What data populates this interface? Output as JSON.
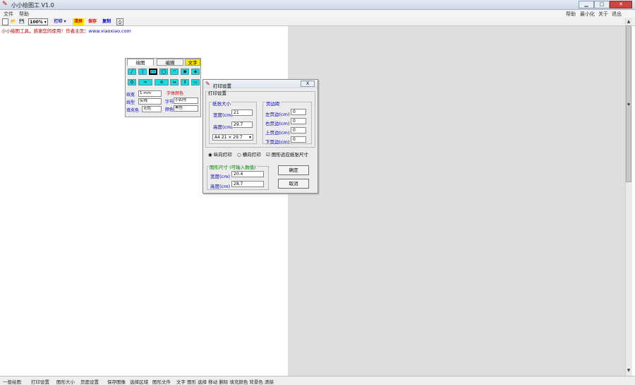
{
  "window": {
    "title": "小小绘图工 V1.0",
    "minimize": "▁",
    "maximize": "□",
    "close": "✕"
  },
  "menubar": {
    "items": [
      "文件",
      "帮助"
    ],
    "right": [
      "帮助",
      "最小化",
      "关于",
      "退出"
    ]
  },
  "toolbar": {
    "zoom": "100%",
    "mode": "打印",
    "buttons": [
      "清屏",
      "保存",
      "复制"
    ],
    "accent_red": "#d40000",
    "accent_blue": "#0000cc"
  },
  "canvas": {
    "url_red": "小小绘图工具，感谢您的使用！作者主页：",
    "url_blue": "www.xiaoxiao.com"
  },
  "palette": {
    "tabs": [
      "绘图",
      "编辑",
      "文字"
    ],
    "row1": [
      "╱",
      "│",
      "□",
      "◯",
      "◠",
      "◉",
      "◈"
    ],
    "row2": [
      "⛭",
      "≈",
      "≋",
      "↔",
      "↕",
      "▭"
    ],
    "fields": [
      {
        "label": "线宽",
        "value": "1 mm"
      },
      {
        "label": "线型",
        "value": "实线"
      },
      {
        "label": "填充色",
        "value": "无色"
      }
    ],
    "right_label": "字体颜色",
    "right_fields": [
      {
        "label": "字号",
        "value": "小四号"
      },
      {
        "label": "颜色",
        "value": "黑色"
      }
    ]
  },
  "dialog": {
    "title": "打印设置",
    "close": "X",
    "group_label": "打印设置",
    "paper_group": "纸张大小",
    "width_label": "宽度(cm)",
    "width_value": "21",
    "height_label": "高度(cm)",
    "height_value": "29.7",
    "paper_select": "A4 21 × 29.7",
    "margin_group": "页边距",
    "margins": [
      {
        "label": "左页边(cm)",
        "value": "0"
      },
      {
        "label": "右页边(cm)",
        "value": "0"
      },
      {
        "label": "上页边(cm)",
        "value": "0"
      },
      {
        "label": "下页边(cm)",
        "value": "0"
      }
    ],
    "radio_portrait": "纵向打印",
    "radio_landscape": "横向打印",
    "checkbox_label": "图形适应纸张尺寸",
    "size_group": "图形尺寸 (可输入数值)",
    "gw_label": "宽度(cm)",
    "gw_value": "20.4",
    "gh_label": "高度(cm)",
    "gh_value": "28.7",
    "ok": "确定",
    "cancel": "取消"
  },
  "statusbar": {
    "items": [
      "一般绘图",
      "打印设置",
      "图形大小",
      "页面设置",
      "保存图像",
      "选择区域",
      "图形文件",
      "文字 图形 选择 移动 删除 填充颜色 背景色 清除"
    ]
  }
}
